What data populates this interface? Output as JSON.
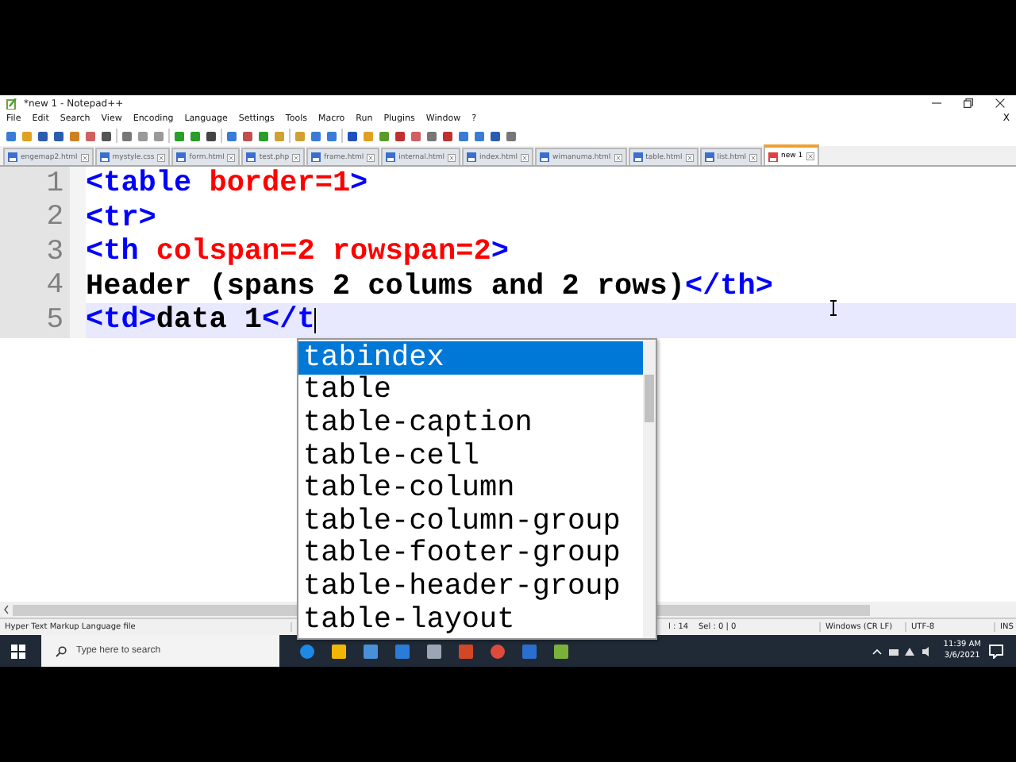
{
  "window": {
    "title": "*new 1 - Notepad++"
  },
  "menu": [
    "File",
    "Edit",
    "Search",
    "View",
    "Encoding",
    "Language",
    "Settings",
    "Tools",
    "Macro",
    "Run",
    "Plugins",
    "Window",
    "?"
  ],
  "menu_close": "X",
  "tabs": [
    {
      "label": "engemap2.html",
      "selected": false,
      "saved": true
    },
    {
      "label": "mystyle.css",
      "selected": false,
      "saved": true
    },
    {
      "label": "form.html",
      "selected": false,
      "saved": true
    },
    {
      "label": "test.php",
      "selected": false,
      "saved": true
    },
    {
      "label": "frame.html",
      "selected": false,
      "saved": true
    },
    {
      "label": "internal.html",
      "selected": false,
      "saved": true
    },
    {
      "label": "index.html",
      "selected": false,
      "saved": true
    },
    {
      "label": "wimanuma.html",
      "selected": false,
      "saved": true
    },
    {
      "label": "table.html",
      "selected": false,
      "saved": true
    },
    {
      "label": "list.html",
      "selected": false,
      "saved": true
    },
    {
      "label": "new 1",
      "selected": true,
      "saved": false
    }
  ],
  "editor": {
    "lines": [
      {
        "number": "1",
        "current": false,
        "tokens": [
          {
            "kind": "tag",
            "text": "<table"
          },
          {
            "kind": "attr",
            "text": " border=1"
          },
          {
            "kind": "tag",
            "text": ">"
          }
        ]
      },
      {
        "number": "2",
        "current": false,
        "tokens": [
          {
            "kind": "tag",
            "text": "<tr>"
          }
        ]
      },
      {
        "number": "3",
        "current": false,
        "tokens": [
          {
            "kind": "tag",
            "text": "<th"
          },
          {
            "kind": "attr",
            "text": " colspan=2 rowspan=2"
          },
          {
            "kind": "tag",
            "text": ">"
          }
        ]
      },
      {
        "number": "4",
        "current": false,
        "tokens": [
          {
            "kind": "text",
            "text": "Header (spans 2 colums and 2 rows)"
          },
          {
            "kind": "tag",
            "text": "</th>"
          }
        ]
      },
      {
        "number": "5",
        "current": true,
        "tokens": [
          {
            "kind": "tag",
            "text": "<td>"
          },
          {
            "kind": "text",
            "text": "data 1"
          },
          {
            "kind": "tag",
            "text": "</t"
          }
        ]
      }
    ]
  },
  "autocomplete": [
    {
      "label": "tabindex",
      "selected": true
    },
    {
      "label": "table",
      "selected": false
    },
    {
      "label": "table-caption",
      "selected": false
    },
    {
      "label": "table-cell",
      "selected": false
    },
    {
      "label": "table-column",
      "selected": false
    },
    {
      "label": "table-column-group",
      "selected": false
    },
    {
      "label": "table-footer-group",
      "selected": false
    },
    {
      "label": "table-header-group",
      "selected": false
    },
    {
      "label": "table-layout",
      "selected": false
    }
  ],
  "status_bar": {
    "file_type": "Hyper Text Markup Language file",
    "position": "l : 14    Sel : 0 | 0",
    "eol": "Windows (CR LF)",
    "encoding": "UTF-8",
    "mode": "INS"
  },
  "taskbar": {
    "search": {
      "placeholder": "Type here to search"
    },
    "time": "11:39 AM",
    "date": "3/6/2021"
  }
}
